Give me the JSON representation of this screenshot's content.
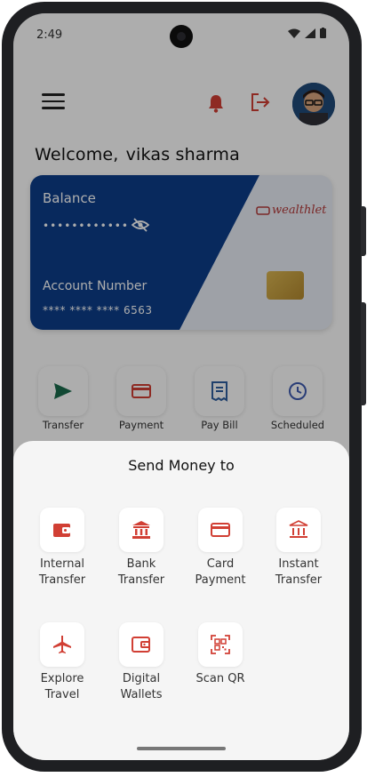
{
  "statusbar": {
    "time": "2:49"
  },
  "header": {
    "welcome_prefix": "Welcome,",
    "user_name": "vikas sharma"
  },
  "card": {
    "balance_label": "Balance",
    "balance_masked": "••••••••••••",
    "brand_name": "wealthlet",
    "account_label": "Account Number",
    "account_masked": "**** **** **** 6563",
    "color_primary": "#0c3d8a"
  },
  "quick_actions": [
    {
      "label": "Transfer",
      "icon": "send-icon"
    },
    {
      "label": "Payment",
      "icon": "credit-card-icon"
    },
    {
      "label": "Pay Bill",
      "icon": "receipt-icon"
    },
    {
      "label": "Scheduled",
      "icon": "clock-icon"
    }
  ],
  "sheet": {
    "title": "Send Money to",
    "options": [
      {
        "line1": "Internal",
        "line2": "Transfer",
        "icon": "wallet-icon"
      },
      {
        "line1": "Bank",
        "line2": "Transfer",
        "icon": "bank-icon"
      },
      {
        "line1": "Card",
        "line2": "Payment",
        "icon": "credit-card-icon"
      },
      {
        "line1": "Instant",
        "line2": "Transfer",
        "icon": "bank-icon"
      },
      {
        "line1": "Explore",
        "line2": "Travel",
        "icon": "airplane-icon"
      },
      {
        "line1": "Digital",
        "line2": "Wallets",
        "icon": "wallet-icon"
      },
      {
        "line1": "Scan QR",
        "line2": "",
        "icon": "qr-scan-icon"
      }
    ]
  },
  "colors": {
    "accent": "#d13f34",
    "sheet_bg": "#f5f5f5"
  }
}
